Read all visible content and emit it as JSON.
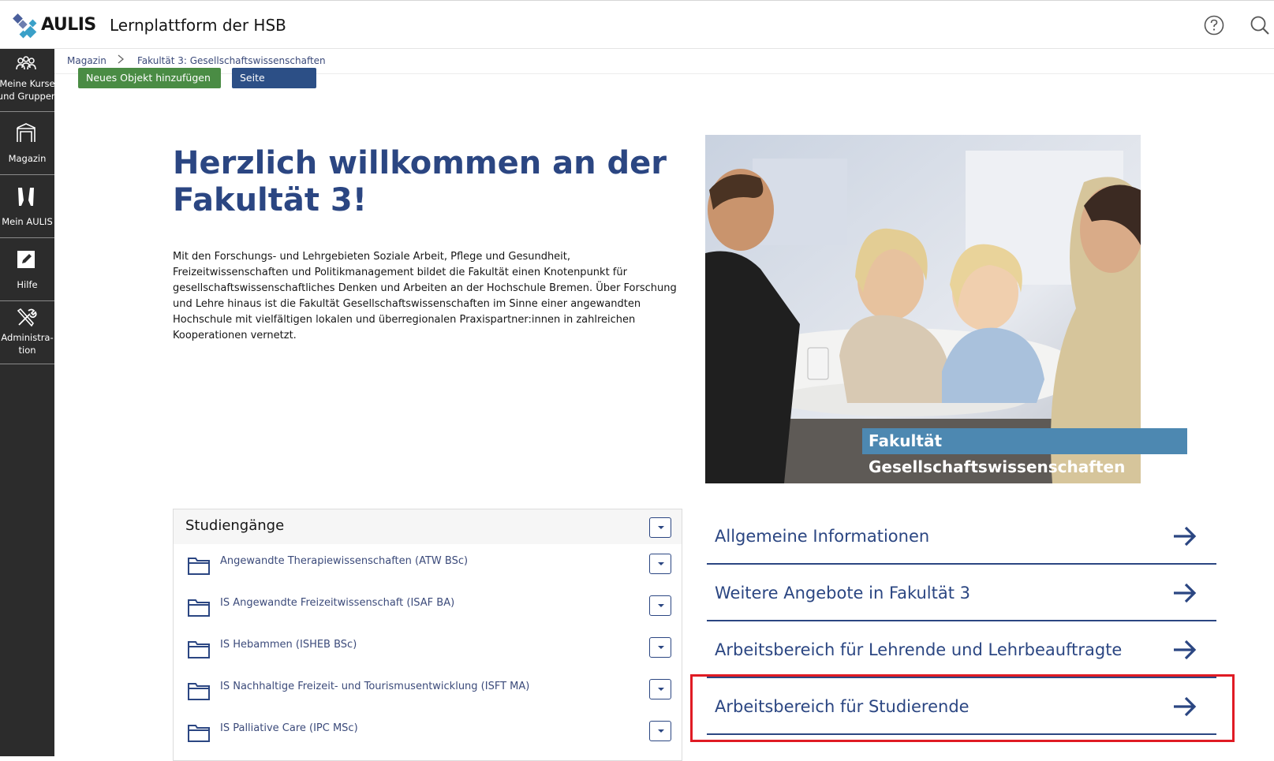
{
  "header": {
    "logo_text": "AULIS",
    "app_title": "Lernplattform der HSB",
    "help_icon": "help-circle-icon",
    "search_icon": "search-icon"
  },
  "sidebar": {
    "items": [
      {
        "label": "Meine Kurse und Gruppen",
        "display": "Meine Kurse\nund Gruppen",
        "icon": "people-icon"
      },
      {
        "label": "Magazin",
        "display": "Magazin",
        "icon": "magazine-icon"
      },
      {
        "label": "Mein AULIS",
        "display": "Mein AULIS",
        "icon": "personal-icon"
      },
      {
        "label": "Hilfe",
        "display": "Hilfe",
        "icon": "help-note-icon"
      },
      {
        "label": "Administration",
        "display": "Administra-\ntion",
        "icon": "tools-icon"
      }
    ]
  },
  "breadcrumb": {
    "items": [
      "Magazin",
      "Fakultät 3: Gesellschaftswissenschaften"
    ]
  },
  "actions": {
    "add_object": "Neues Objekt hinzufügen",
    "design_page": "Seite gestalten"
  },
  "main": {
    "welcome": "Herzlich willkommen an der Fakultät 3!",
    "intro": "Mit den Forschungs- und Lehrgebieten Soziale Arbeit, Pflege und Gesundheit, Freizeitwissenschaften und Politikmanagement bildet die Fakultät einen Knotenpunkt für gesellschaftswissenschaftliches Denken und Arbeiten an der Hochschule Bremen. Über Forschung und Lehre hinaus ist die Fakultät Gesellschaftswissenschaften im Sinne einer angewandten Hochschule mit vielfältigen lokalen und überregionalen Praxispartner:innen in zahlreichen Kooperationen vernetzt.",
    "image_caption": "Fakultät Gesellschaftswissenschaften"
  },
  "studiengaenge": {
    "title": "Studiengänge",
    "items": [
      "Angewandte Therapiewissenschaften (ATW BSc)",
      "IS Angewandte Freizeitwissenschaft (ISAF BA)",
      "IS Hebammen (ISHEB BSc)",
      "IS Nachhaltige Freizeit- und Tourismusentwicklung (ISFT MA)",
      "IS Palliative Care (IPC MSc)"
    ]
  },
  "links": [
    "Allgemeine Informationen",
    "Weitere Angebote in Fakultät 3",
    "Arbeitsbereich für Lehrende und Lehrbeauftragte",
    "Arbeitsbereich für Studierende"
  ],
  "colors": {
    "primary": "#2b4682",
    "sidebar": "#2c2c2c",
    "add_button": "#4a8c44",
    "design_button": "#2c4f86",
    "caption": "#4d88b1",
    "highlight": "#e01b24"
  }
}
